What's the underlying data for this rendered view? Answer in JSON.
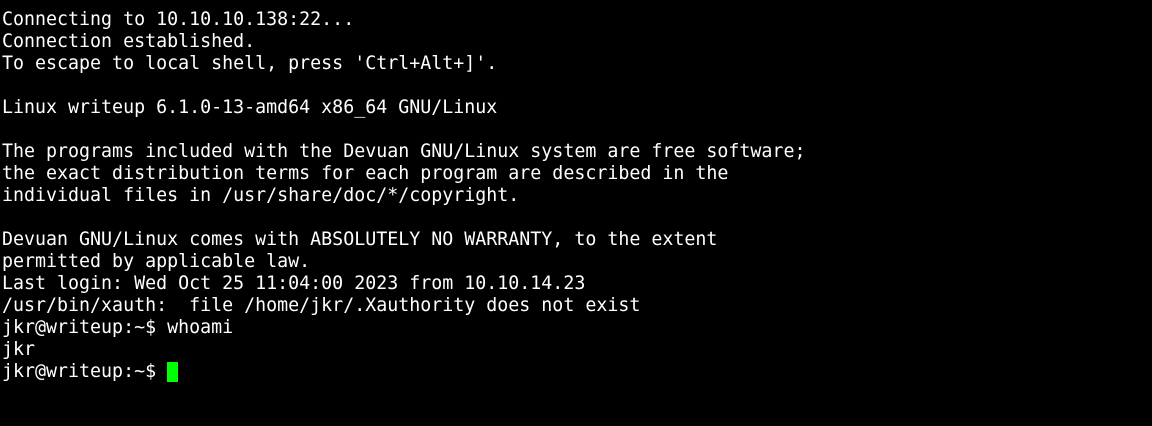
{
  "terminal": {
    "lines": [
      "Connecting to 10.10.10.138:22...",
      "Connection established.",
      "To escape to local shell, press 'Ctrl+Alt+]'.",
      "",
      "Linux writeup 6.1.0-13-amd64 x86_64 GNU/Linux",
      "",
      "The programs included with the Devuan GNU/Linux system are free software;",
      "the exact distribution terms for each program are described in the",
      "individual files in /usr/share/doc/*/copyright.",
      "",
      "Devuan GNU/Linux comes with ABSOLUTELY NO WARRANTY, to the extent",
      "permitted by applicable law.",
      "Last login: Wed Oct 25 11:04:00 2023 from 10.10.14.23",
      "/usr/bin/xauth:  file /home/jkr/.Xauthority does not exist",
      "jkr@writeup:~$ whoami",
      "jkr"
    ],
    "prompt": "jkr@writeup:~$",
    "cursor_color": "#00ff00",
    "background_color": "#000000",
    "text_color": "#ffffff"
  }
}
